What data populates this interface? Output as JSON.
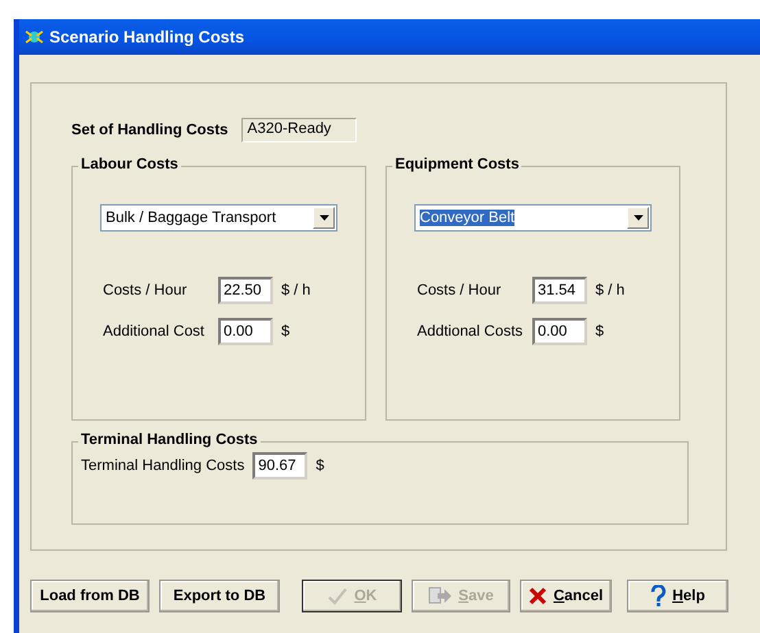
{
  "window": {
    "title": "Scenario Handling Costs"
  },
  "set": {
    "label": "Set of Handling Costs",
    "value": "A320-Ready"
  },
  "groups": [
    {
      "title": "Labour Costs",
      "combo": {
        "value": "Bulk / Baggage Transport",
        "highlighted": false
      },
      "rows": [
        {
          "label": "Costs / Hour",
          "value": "22.50",
          "unit": "$ / h"
        },
        {
          "label": "Additional Cost",
          "value": "0.00",
          "unit": "$"
        }
      ]
    },
    {
      "title": "Equipment Costs",
      "combo": {
        "value": "Conveyor Belt",
        "highlighted": true
      },
      "rows": [
        {
          "label": "Costs / Hour",
          "value": "31.54",
          "unit": "$ / h"
        },
        {
          "label": "Addtional Costs",
          "value": "0.00",
          "unit": "$"
        }
      ]
    }
  ],
  "terminal": {
    "title": "Terminal Handling Costs",
    "label": "Terminal Handling Costs",
    "value": "90.67",
    "unit": "$"
  },
  "buttons": [
    {
      "label": "Load from DB",
      "kind": "plain",
      "disabled": false,
      "mnemonic": false,
      "default": false
    },
    {
      "label": "Export to DB",
      "kind": "plain",
      "disabled": false,
      "mnemonic": false,
      "default": false
    },
    {
      "label": "OK",
      "kind": "confirm",
      "disabled": true,
      "mnemonic": true,
      "default": true
    },
    {
      "label": "Save",
      "kind": "store",
      "disabled": true,
      "mnemonic": true,
      "default": false
    },
    {
      "label": "Cancel",
      "kind": "abort",
      "disabled": false,
      "mnemonic": true,
      "default": false
    },
    {
      "label": "Help",
      "kind": "assist",
      "disabled": false,
      "mnemonic": true,
      "default": false
    }
  ]
}
